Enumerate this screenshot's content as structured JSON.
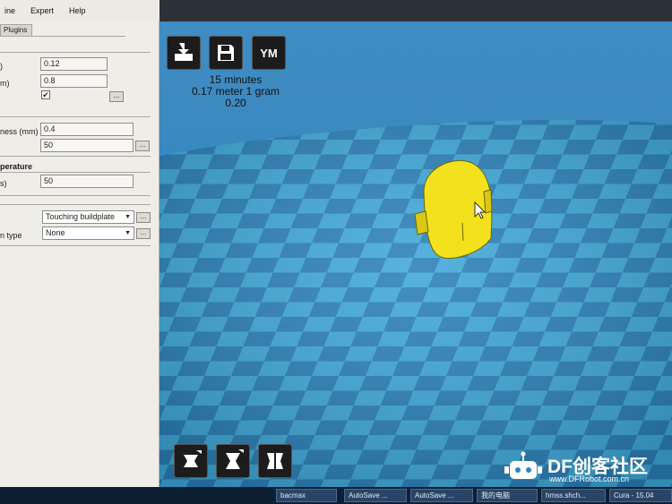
{
  "menu": {
    "items": [
      "ine",
      "Expert",
      "Help"
    ]
  },
  "panel": {
    "tab_label": "Plugins",
    "row1_label": ")",
    "row1_value": "0.12",
    "row2_label": "m)",
    "row2_value": "0.8",
    "checkbox_mark": "✔",
    "dots": "...",
    "shell_label": "ness (mm)",
    "shell_value": "0.4",
    "row4_value": "50",
    "section_temp": "perature",
    "temp_label": "s)",
    "temp_value": "50",
    "support_value": "Touching buildplate",
    "adhesion_label": "n type",
    "adhesion_value": "None",
    "arrow": "▼"
  },
  "viewport": {
    "load_icon": "load-model-icon",
    "save_icon": "save-sd-icon",
    "ym_label": "YM",
    "print_time": "15 minutes",
    "material": "0.17 meter 1 gram",
    "cost": "0.20",
    "colors": {
      "sky": "#3d8ac0",
      "tile_light": "#3fa8d8",
      "tile_dark": "#2b80b8",
      "model": "#f2e11c"
    }
  },
  "taskbar": {
    "items": [
      "bacmax",
      "AutoSave ...",
      "AutoSave ...",
      "我的电脑",
      "hmss.shch...",
      "Cura - 15.04"
    ]
  },
  "watermark": {
    "title": "DF创客社区",
    "url": "www.DFRobot.com.cn"
  }
}
